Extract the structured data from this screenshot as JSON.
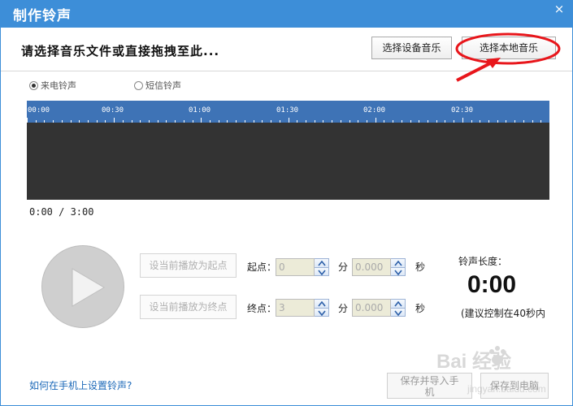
{
  "window": {
    "title": "制作铃声",
    "close_glyph": "×"
  },
  "header": {
    "prompt": "请选择音乐文件或直接拖拽至此...",
    "device_music_button": "选择设备音乐",
    "local_music_button": "选择本地音乐"
  },
  "ring_type": {
    "options": [
      {
        "label": "来电铃声",
        "selected": true
      },
      {
        "label": "短信铃声",
        "selected": false
      }
    ]
  },
  "timeline": {
    "labels": [
      "00:00",
      "00:30",
      "01:00",
      "01:30",
      "02:00",
      "02:30"
    ]
  },
  "playback": {
    "timecode": "0:00 / 3:00"
  },
  "controls": {
    "set_start_button": "设当前播放为起点",
    "set_end_button": "设当前播放为终点",
    "start_label": "起点：",
    "end_label": "终点：",
    "start_minutes": "0",
    "start_seconds": "0.000",
    "end_minutes": "3",
    "end_seconds": "0.000",
    "minute_unit": "分",
    "second_unit": "秒"
  },
  "ringtone": {
    "length_label": "铃声长度：",
    "length_value": "0:00",
    "hint": "(建议控制在40秒内"
  },
  "footer": {
    "help_link": "如何在手机上设置铃声?",
    "save_phone_line1": "保存并导入手",
    "save_phone_line2": "机",
    "save_pc": "保存到电脑"
  },
  "watermark": {
    "text": "Bai 经验",
    "sub": "jingyan.baidu.com"
  },
  "colors": {
    "titlebar": "#3d8ed8",
    "timeline_bar": "#3e73b6",
    "waveform_bg": "#333333",
    "annotation_red": "#e8161b",
    "link": "#1b68b8"
  }
}
